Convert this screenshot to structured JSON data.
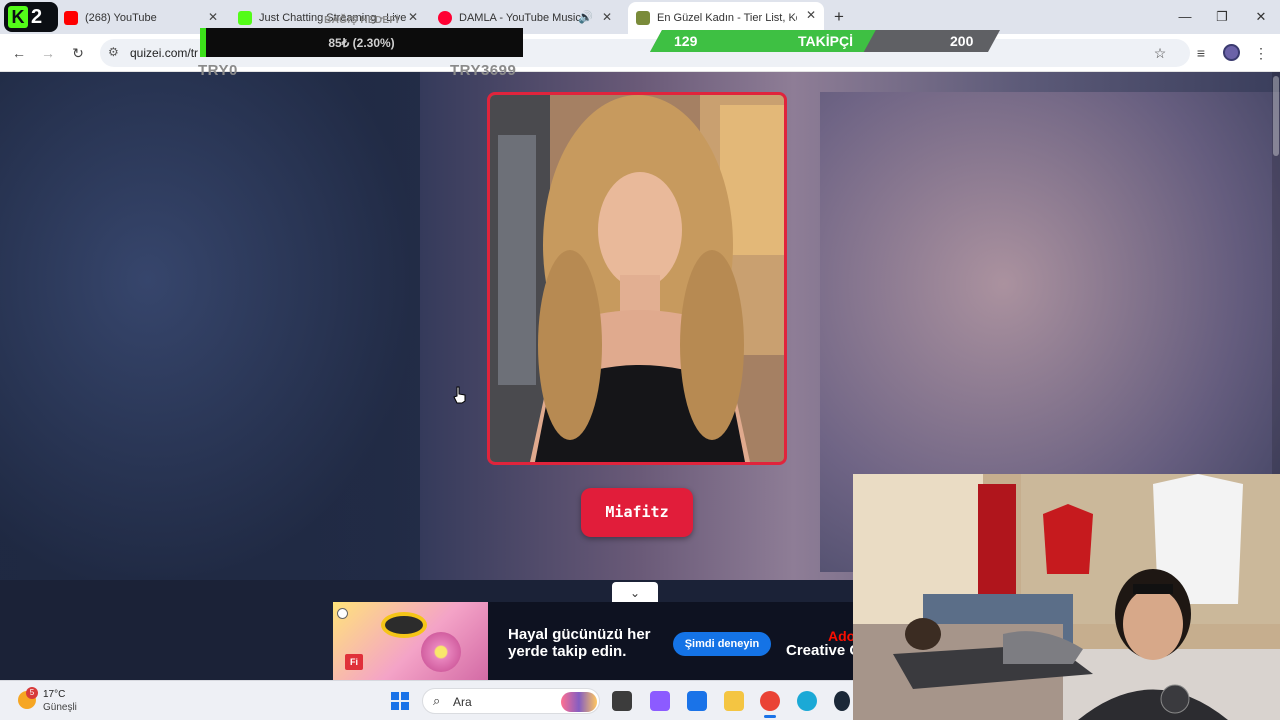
{
  "browser": {
    "tabs": [
      {
        "title": "(268) YouTube",
        "favicon": "youtube-icon",
        "color": "#ff0000"
      },
      {
        "title": "Just Chatting Streaming - Live",
        "favicon": "kick-icon",
        "color": "#53fc18"
      },
      {
        "title": "DAMLA - YouTube Music",
        "favicon": "youtube-music-icon",
        "color": "#ff0033"
      },
      {
        "title": "En Güzel Kadın - Tier List, Kör S",
        "favicon": "quizei-icon",
        "color": "#7a8b3a",
        "active": true
      }
    ],
    "address": "quizei.com/tr"
  },
  "overlay": {
    "kick_digit": "2",
    "goal": {
      "title": "BAĞIŞ HEDEFİ",
      "amount_text": "85₺ (2.30%)",
      "progress_percent": 2.3,
      "min_label": "TRY0",
      "max_label": "TRY3699"
    },
    "followers": {
      "current": "129",
      "label": "TAKİPÇİ",
      "target": "200",
      "current_value": 129,
      "target_value": 200
    }
  },
  "quiz": {
    "contestant_name": "Miafitz"
  },
  "ad": {
    "headline": "Hayal gücünüzü her yerde takip edin.",
    "cta": "Şimdi deneyin",
    "brand": "Creative C",
    "brand_mark": "Ado",
    "badge": "Fi"
  },
  "taskbar": {
    "weather_temp": "17°C",
    "weather_condition": "Güneşli",
    "weather_badge": "5",
    "search_placeholder": "Ara",
    "apps": [
      {
        "name": "task-view-icon",
        "color": "#3c3c3c"
      },
      {
        "name": "copilot-icon",
        "color": "#8c5bff"
      },
      {
        "name": "store-icon",
        "color": "#1a73e8"
      },
      {
        "name": "file-explorer-icon",
        "color": "#f4c542"
      },
      {
        "name": "chrome-icon",
        "color": "#ea4335",
        "active": true
      },
      {
        "name": "edge-icon",
        "color": "#1ba9d6"
      },
      {
        "name": "steam-icon",
        "color": "#1b2838"
      }
    ]
  },
  "colors": {
    "accent": "#e11d3a",
    "goal_fill": "#3ce11a",
    "follower_fill": "#3ec043"
  }
}
